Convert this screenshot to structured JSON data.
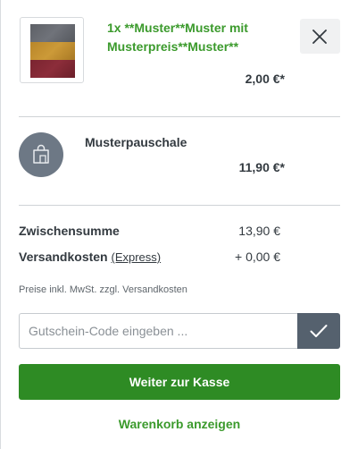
{
  "items": [
    {
      "title": "1x **Muster**Muster mit Musterpreis**Muster**",
      "price": "2,00 €*",
      "icon": "product-thumbnail"
    },
    {
      "title": "Musterpauschale",
      "price": "11,90 €*",
      "icon": "shopping-bag-icon"
    }
  ],
  "close_icon": "close-icon",
  "summary": {
    "subtotal_label": "Zwischensumme",
    "subtotal_value": "13,90 €",
    "shipping_label": "Versandkosten",
    "shipping_method": "(Express)",
    "shipping_value": "+ 0,00 €",
    "tax_note": "Preise inkl. MwSt. zzgl. Versandkosten"
  },
  "voucher": {
    "placeholder": "Gutschein-Code eingeben ...",
    "submit_icon": "checkmark-icon"
  },
  "actions": {
    "checkout_label": "Weiter zur Kasse",
    "view_cart_label": "Warenkorb anzeigen"
  },
  "colors": {
    "accent_green": "#3b9a2c",
    "button_green": "#2e8b24",
    "voucher_button": "#55616e",
    "bag_circle": "#6d7885"
  }
}
